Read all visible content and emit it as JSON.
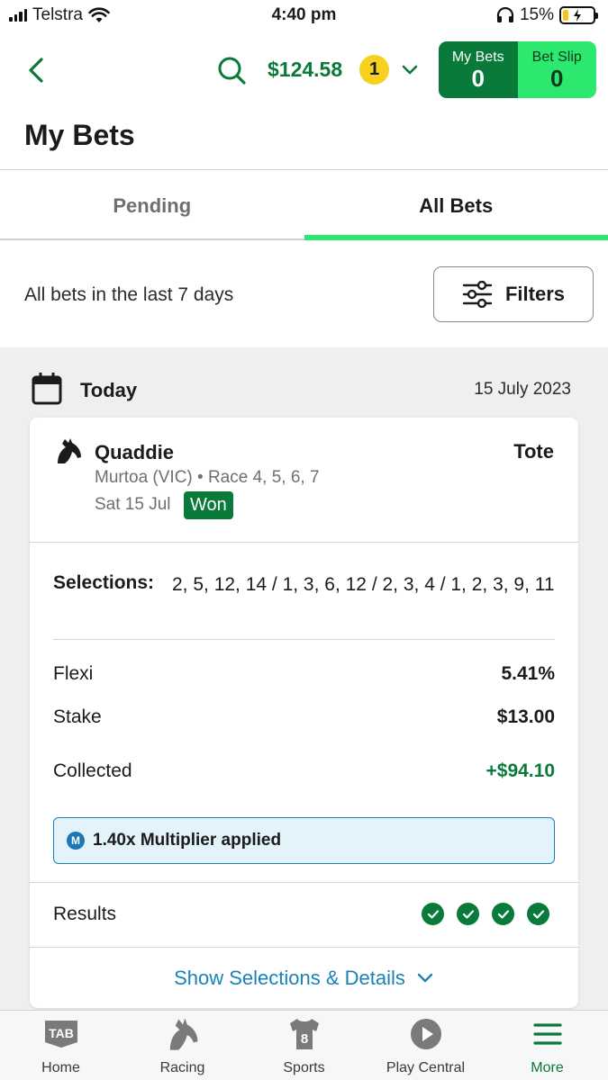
{
  "status_bar": {
    "carrier": "Telstra",
    "time": "4:40 pm",
    "battery": "15%"
  },
  "header": {
    "balance": "$124.58",
    "notification_count": "1",
    "my_bets_label": "My Bets",
    "my_bets_count": "0",
    "bet_slip_label": "Bet Slip",
    "bet_slip_count": "0"
  },
  "page_title": "My Bets",
  "tabs": [
    {
      "label": "Pending",
      "active": false
    },
    {
      "label": "All Bets",
      "active": true
    }
  ],
  "range_text": "All bets in the last 7 days",
  "filters_label": "Filters",
  "day_group": {
    "label": "Today",
    "date": "15 July 2023"
  },
  "bet_card": {
    "bet_type": "Quaddie",
    "kind": "Tote",
    "meeting": "Murtoa (VIC) • Race 4, 5, 6, 7",
    "date": "Sat 15 Jul",
    "status": "Won",
    "selections_label": "Selections:",
    "selections": "2, 5, 12, 14 / 1, 3, 6, 12 / 2, 3, 4 / 1, 2, 3, 9, 11",
    "flexi_label": "Flexi",
    "flexi_value": "5.41%",
    "stake_label": "Stake",
    "stake_value": "$13.00",
    "collected_label": "Collected",
    "collected_value": "+$94.10",
    "multiplier_icon_letter": "M",
    "multiplier_text": "1.40x Multiplier applied",
    "results_label": "Results",
    "results": [
      "won",
      "won",
      "won",
      "won"
    ],
    "details_link": "Show Selections & Details"
  },
  "bottom_nav": [
    {
      "label": "Home",
      "icon": "tab-logo-icon",
      "badge": "TAB"
    },
    {
      "label": "Racing",
      "icon": "horse-icon"
    },
    {
      "label": "Sports",
      "icon": "jersey-icon",
      "badge": "8"
    },
    {
      "label": "Play Central",
      "icon": "play-icon"
    },
    {
      "label": "More",
      "icon": "menu-icon",
      "active": true
    }
  ],
  "colors": {
    "brand_green": "#0a7a3a",
    "accent_green": "#2de86e",
    "link_blue": "#1b82b8",
    "badge_yellow": "#f7d11e"
  }
}
